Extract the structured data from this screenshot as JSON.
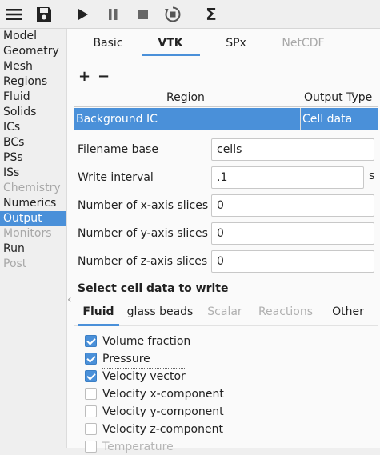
{
  "toolbar": {
    "icons": [
      "menu-icon",
      "save-icon",
      "run-icon",
      "pause-icon",
      "stop-icon",
      "reset-icon",
      "sigma-icon"
    ]
  },
  "nav": {
    "items": [
      {
        "label": "Model",
        "state": "normal"
      },
      {
        "label": "Geometry",
        "state": "normal"
      },
      {
        "label": "Mesh",
        "state": "normal"
      },
      {
        "label": "Regions",
        "state": "normal"
      },
      {
        "label": "Fluid",
        "state": "normal"
      },
      {
        "label": "Solids",
        "state": "normal"
      },
      {
        "label": "ICs",
        "state": "normal"
      },
      {
        "label": "BCs",
        "state": "normal"
      },
      {
        "label": "PSs",
        "state": "normal"
      },
      {
        "label": "ISs",
        "state": "normal"
      },
      {
        "label": "Chemistry",
        "state": "disabled"
      },
      {
        "label": "Numerics",
        "state": "normal"
      },
      {
        "label": "Output",
        "state": "selected"
      },
      {
        "label": "Monitors",
        "state": "disabled"
      },
      {
        "label": "Run",
        "state": "normal"
      },
      {
        "label": "Post",
        "state": "disabled"
      }
    ]
  },
  "tabs": [
    {
      "label": "Basic",
      "state": "normal"
    },
    {
      "label": "VTK",
      "state": "active"
    },
    {
      "label": "SPx",
      "state": "normal"
    },
    {
      "label": "NetCDF",
      "state": "disabled"
    }
  ],
  "region_buttons": {
    "add": "+",
    "remove": "−"
  },
  "table": {
    "headers": {
      "region": "Region",
      "output_type": "Output Type"
    },
    "rows": [
      {
        "region": "Background IC",
        "output_type": "Cell data"
      }
    ]
  },
  "fields": {
    "filename_base": {
      "label": "Filename base",
      "value": "cells"
    },
    "write_interval": {
      "label": "Write interval",
      "value": ".1",
      "unit": "s"
    },
    "x_slices": {
      "label": "Number of x-axis slices",
      "value": "0"
    },
    "y_slices": {
      "label": "Number of y-axis slices",
      "value": "0"
    },
    "z_slices": {
      "label": "Number of z-axis slices",
      "value": "0"
    }
  },
  "cell_data": {
    "title": "Select cell data to write",
    "subtabs": [
      {
        "label": "Fluid",
        "state": "active"
      },
      {
        "label": "glass beads",
        "state": "normal"
      },
      {
        "label": "Scalar",
        "state": "disabled"
      },
      {
        "label": "Reactions",
        "state": "disabled"
      },
      {
        "label": "Other",
        "state": "normal"
      }
    ],
    "options": [
      {
        "label": "Volume fraction",
        "checked": true
      },
      {
        "label": "Pressure",
        "checked": true
      },
      {
        "label": "Velocity vector",
        "checked": true
      },
      {
        "label": "Velocity x-component",
        "checked": false
      },
      {
        "label": "Velocity y-component",
        "checked": false
      },
      {
        "label": "Velocity z-component",
        "checked": false
      },
      {
        "label": "Temperature",
        "checked": false
      }
    ]
  },
  "colors": {
    "accent": "#4a90d9",
    "disabled_text": "#a8a8a8"
  }
}
